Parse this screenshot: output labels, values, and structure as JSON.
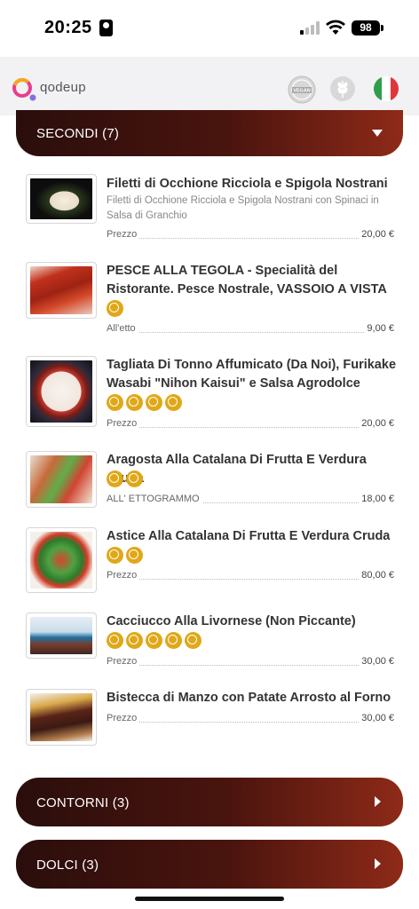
{
  "status_bar": {
    "time": "20:25",
    "battery": "98"
  },
  "header": {
    "logo_text": "qodeup",
    "vegan_badge_text": "VEGAN"
  },
  "categories": {
    "secondi": {
      "label": "SECONDI",
      "count": "(7)"
    },
    "contorni": {
      "label": "CONTORNI",
      "count": "(3)"
    },
    "dolci": {
      "label": "DOLCI",
      "count": "(3)"
    }
  },
  "items": [
    {
      "name": "Filetti di Occhione Ricciola e Spigola Nostrani",
      "description": "Filetti di Occhione Ricciola e Spigola Nostrani con Spinaci in Salsa di Granchio",
      "allergens": [],
      "price_label": "Prezzo",
      "price": "20,00 €"
    },
    {
      "name": "PESCE ALLA TEGOLA - Specialità del Ristorante. Pesce Nostrale, VASSOIO A VISTA",
      "description": "",
      "allergens": [
        "fish-icon"
      ],
      "price_label": "All'etto",
      "price": "9,00 €"
    },
    {
      "name": "Tagliata Di Tonno Affumicato (Da Noi), Furikake Wasabi \"Nihon Kaisui\" e Salsa Agrodolce",
      "description": "",
      "allergens": [
        "fish-icon",
        "celery-icon",
        "mustard-icon",
        "soy-icon"
      ],
      "price_label": "Prezzo",
      "price": "20,00 €"
    },
    {
      "name": "Aragosta Alla Catalana Di Frutta E Verdura Cruda",
      "description": "",
      "allergens": [
        "crustaceans-icon",
        "celery-icon"
      ],
      "price_label": "ALL' ETTOGRAMMO",
      "price": "18,00 €"
    },
    {
      "name": "Astice Alla Catalana Di Frutta E Verdura Cruda",
      "description": "",
      "allergens": [
        "crustaceans-icon",
        "celery-icon"
      ],
      "price_label": "Prezzo",
      "price": "80,00 €"
    },
    {
      "name": "Cacciucco Alla Livornese (Non Piccante)",
      "description": "",
      "allergens": [
        "gluten-icon",
        "fish-icon",
        "crustaceans-icon",
        "molluscs-icon",
        "sesame-icon"
      ],
      "price_label": "Prezzo",
      "price": "30,00 €"
    },
    {
      "name": "Bistecca di Manzo con Patate Arrosto al Forno",
      "description": "",
      "allergens": [],
      "price_label": "Prezzo",
      "price": "30,00 €"
    }
  ],
  "colors": {
    "brand": "#4a140e",
    "allergen": "#e0a818"
  }
}
